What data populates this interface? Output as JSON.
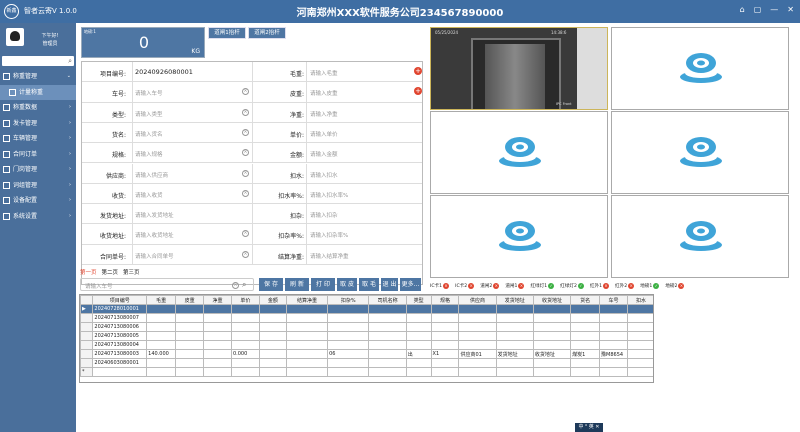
{
  "window": {
    "logo_text": "新鑫",
    "app_name": "智者云寄V 1.0.0",
    "company_title": "河南郑州XXX软件服务公司234567890000",
    "controls": [
      "⌂",
      "▢",
      "—",
      "✕"
    ]
  },
  "sidebar": {
    "greeting": "下午好!",
    "role": "管理员",
    "menu": [
      {
        "label": "称重管理",
        "chev": "⌄"
      },
      {
        "label": "计量称重",
        "chev": ""
      },
      {
        "label": "称重数据",
        "chev": "›"
      },
      {
        "label": "发卡管理",
        "chev": "›"
      },
      {
        "label": "车辆管理",
        "chev": "›"
      },
      {
        "label": "合同订单",
        "chev": "›"
      },
      {
        "label": "门岗管理",
        "chev": "›"
      },
      {
        "label": "词组管理",
        "chev": "›"
      },
      {
        "label": "设备配置",
        "chev": "›"
      },
      {
        "label": "系统设置",
        "chev": "›"
      }
    ]
  },
  "weight": {
    "label": "地磅:1",
    "value": "0",
    "unit": "KG"
  },
  "gates": {
    "gate1": "道闸1抬杆",
    "gate2": "道闸2抬杆"
  },
  "form": {
    "rows": [
      {
        "l1": "项目编号:",
        "v1": "20240926080001",
        "l2": "毛重:",
        "v2": "请输入毛重"
      },
      {
        "l1": "车号:",
        "v1": "请输入车号",
        "l2": "皮重:",
        "v2": "请输入皮重"
      },
      {
        "l1": "类型:",
        "v1": "请输入类型",
        "l2": "净重:",
        "v2": "请输入净重"
      },
      {
        "l1": "货名:",
        "v1": "请输入货名",
        "l2": "单价:",
        "v2": "请输入单价"
      },
      {
        "l1": "规格:",
        "v1": "请输入规格",
        "l2": "金额:",
        "v2": "请输入金额"
      },
      {
        "l1": "供应商:",
        "v1": "请输入供应商",
        "l2": "扣水:",
        "v2": "请输入扣水"
      },
      {
        "l1": "收货:",
        "v1": "请输入收货",
        "l2": "扣水率%:",
        "v2": "请输入扣水率%"
      },
      {
        "l1": "发货地址:",
        "v1": "请输入发货地址",
        "l2": "扣杂:",
        "v2": "请输入扣杂"
      },
      {
        "l1": "收货地址:",
        "v1": "请输入收货地址",
        "l2": "扣杂率%:",
        "v2": "请输入扣杂率%"
      },
      {
        "l1": "合同单号:",
        "v1": "请输入合同单号",
        "l2": "结算净重:",
        "v2": "请输入结算净重"
      }
    ]
  },
  "pager": {
    "page1": "第一页",
    "page2": "第二页",
    "page3": "第三页"
  },
  "toolbar": {
    "search_placeholder": "请输入车号",
    "save": "保 存",
    "refresh": "刷 新",
    "print": "打 印",
    "take_skin": "取 皮",
    "take_gross": "取 毛",
    "exit": "退 出",
    "more": "更多..."
  },
  "table": {
    "headers": [
      "项目编号",
      "毛重",
      "皮重",
      "净重",
      "单价",
      "金额",
      "结算净重",
      "扣杂%",
      "司机名称",
      "类型",
      "规格",
      "供应商",
      "发货地址",
      "收货地址",
      "货名",
      "车号",
      "扣水"
    ],
    "rows": [
      {
        "cells": [
          "20240728010001",
          "",
          "",
          "",
          "",
          "",
          "",
          "",
          "",
          "",
          "",
          "",
          "",
          "",
          "",
          "",
          ""
        ],
        "selected": true,
        "marker": "▶"
      },
      {
        "cells": [
          "20240713080007",
          "",
          "",
          "",
          "",
          "",
          "",
          "",
          "",
          "",
          "",
          "",
          "",
          "",
          "",
          "",
          ""
        ],
        "selected": false,
        "marker": ""
      },
      {
        "cells": [
          "20240713080006",
          "",
          "",
          "",
          "",
          "",
          "",
          "",
          "",
          "",
          "",
          "",
          "",
          "",
          "",
          "",
          ""
        ],
        "selected": false,
        "marker": ""
      },
      {
        "cells": [
          "20240713080005",
          "",
          "",
          "",
          "",
          "",
          "",
          "",
          "",
          "",
          "",
          "",
          "",
          "",
          "",
          "",
          ""
        ],
        "selected": false,
        "marker": ""
      },
      {
        "cells": [
          "20240713080004",
          "",
          "",
          "",
          "",
          "",
          "",
          "",
          "",
          "",
          "",
          "",
          "",
          "",
          "",
          "",
          ""
        ],
        "selected": false,
        "marker": ""
      },
      {
        "cells": [
          "20240713080003",
          "140.000",
          "",
          "",
          "0.000",
          "",
          "",
          "06",
          "",
          "出",
          "X1",
          "供应商01",
          "发货地址",
          "收货地址",
          "煤炭1",
          "豫M8654",
          ""
        ],
        "selected": false,
        "marker": ""
      },
      {
        "cells": [
          "20240603080001",
          "",
          "",
          "",
          "",
          "",
          "",
          "",
          "",
          "",
          "",
          "",
          "",
          "",
          "",
          "",
          ""
        ],
        "selected": false,
        "marker": ""
      },
      {
        "cells": [
          "",
          "",
          "",
          "",
          "",
          "",
          "",
          "",
          "",
          "",
          "",
          "",
          "",
          "",
          "",
          "",
          ""
        ],
        "selected": false,
        "marker": "*"
      }
    ]
  },
  "camera": {
    "timestamp": "05/25/2024",
    "time": "14:38:6",
    "channel": "IPC Front"
  },
  "devices": [
    {
      "label": "IC卡1",
      "on": false
    },
    {
      "label": "IC卡2",
      "on": false
    },
    {
      "label": "道闸2",
      "on": false
    },
    {
      "label": "道闸1",
      "on": false
    },
    {
      "label": "红绿灯1",
      "on": true
    },
    {
      "label": "红绿灯2",
      "on": true
    },
    {
      "label": "红外1",
      "on": false
    },
    {
      "label": "红外2",
      "on": false
    },
    {
      "label": "地磅1",
      "on": true
    },
    {
      "label": "地磅2",
      "on": false
    }
  ],
  "ime": "中 ⁰ 英 ✕"
}
